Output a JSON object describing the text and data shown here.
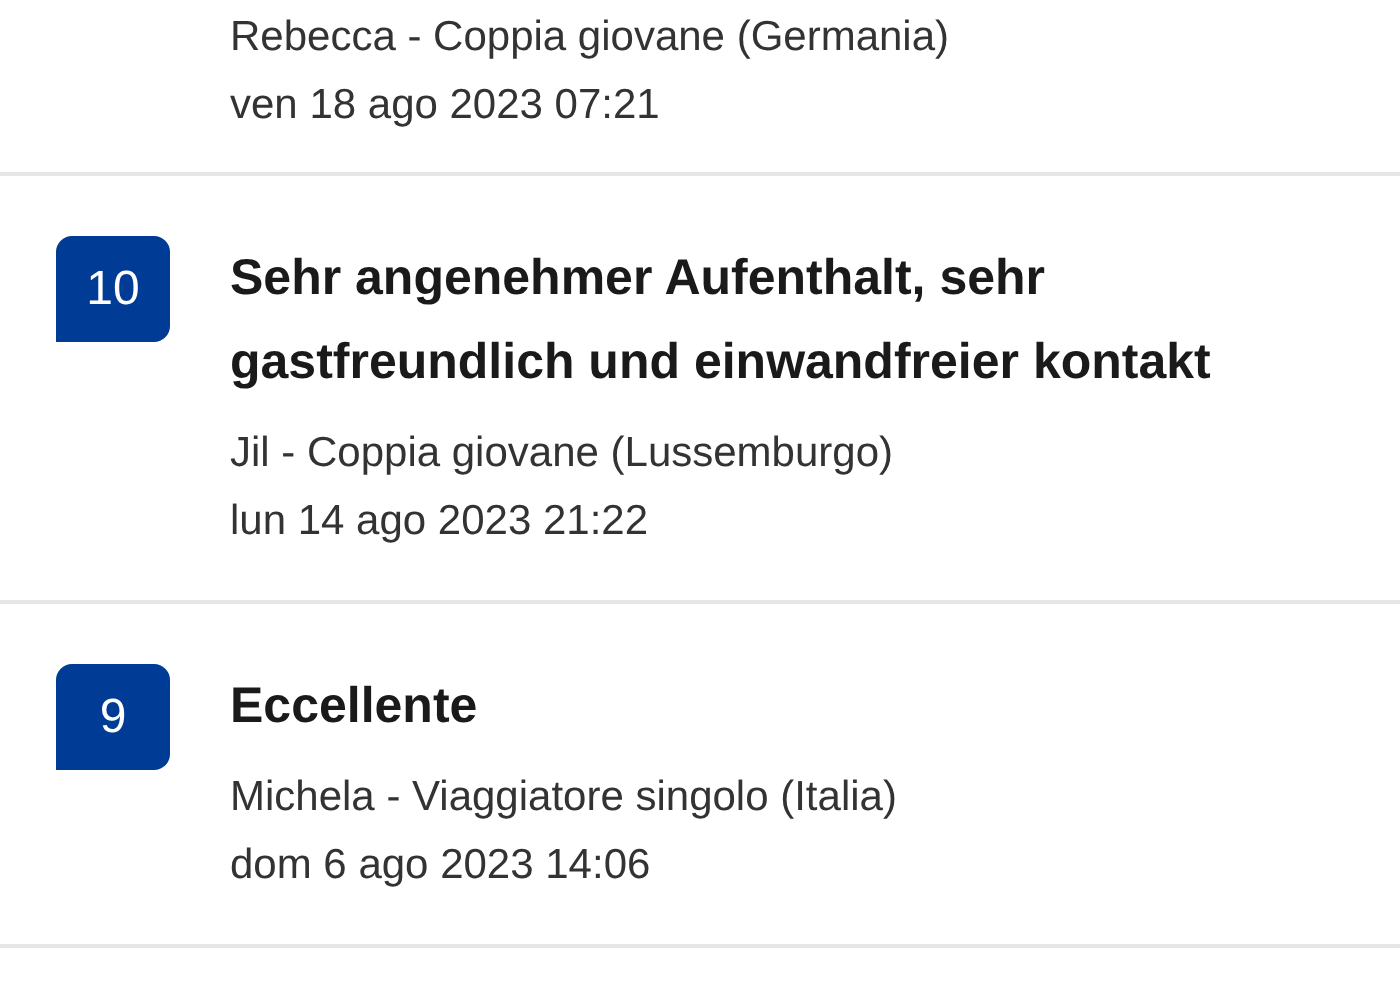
{
  "reviews": [
    {
      "author": "Rebecca - Coppia giovane (Germania)",
      "date": "ven 18 ago 2023 07:21"
    },
    {
      "score": "10",
      "title": "Sehr angenehmer Aufenthalt, sehr gastfreundlich und einwandfreier kontakt",
      "author": "Jil - Coppia giovane (Lussemburgo)",
      "date": "lun 14 ago 2023 21:22"
    },
    {
      "score": "9",
      "title": "Eccellente",
      "author": "Michela - Viaggiatore singolo (Italia)",
      "date": "dom 6 ago 2023 14:06"
    }
  ]
}
